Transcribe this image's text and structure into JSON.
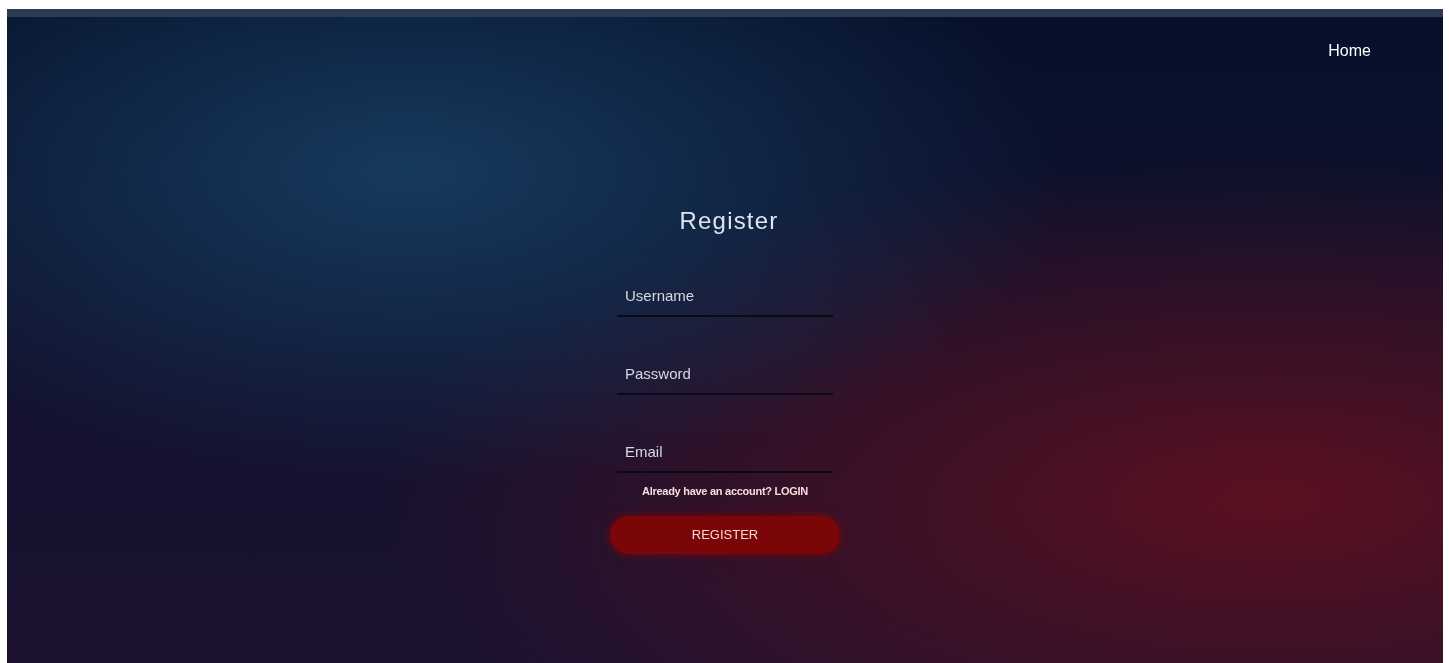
{
  "nav": {
    "links": [
      "Home"
    ]
  },
  "form": {
    "title": "Register",
    "fields": [
      {
        "placeholder": "Username"
      },
      {
        "placeholder": "Password"
      },
      {
        "placeholder": "Email"
      }
    ],
    "login_prompt": "Already have an account? LOGIN",
    "submit": "REGISTER"
  }
}
